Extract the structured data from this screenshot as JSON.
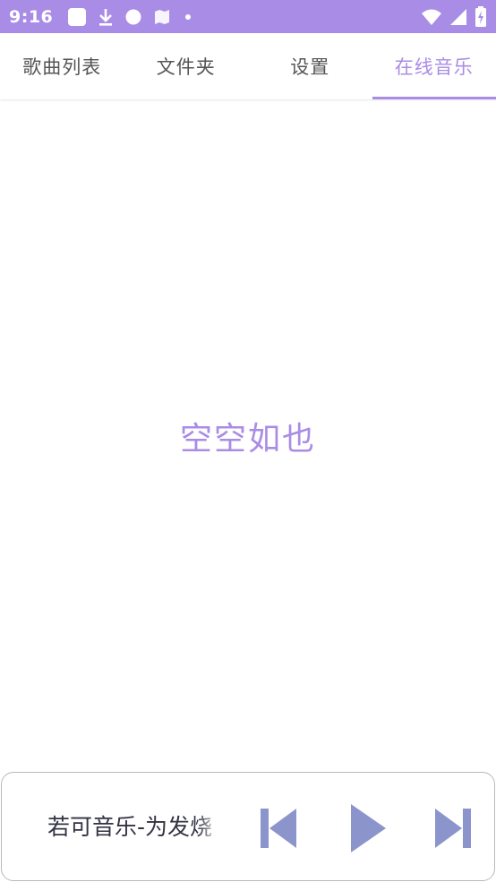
{
  "status_bar": {
    "time": "9:16",
    "left_icons": [
      "square-icon",
      "download-icon",
      "circle-icon",
      "map-icon",
      "dot-icon"
    ],
    "right_icons": [
      "wifi-icon",
      "signal-icon",
      "battery-charging-icon"
    ]
  },
  "tabs": [
    {
      "label": "歌曲列表",
      "active": false
    },
    {
      "label": "文件夹",
      "active": false
    },
    {
      "label": "设置",
      "active": false
    },
    {
      "label": "在线音乐",
      "active": true
    }
  ],
  "main": {
    "empty_text": "空空如也"
  },
  "player": {
    "song_title": "若可音乐-为发烧"
  },
  "colors": {
    "accent": "#a98ce6",
    "control": "#8c94cc",
    "text": "#555555"
  }
}
